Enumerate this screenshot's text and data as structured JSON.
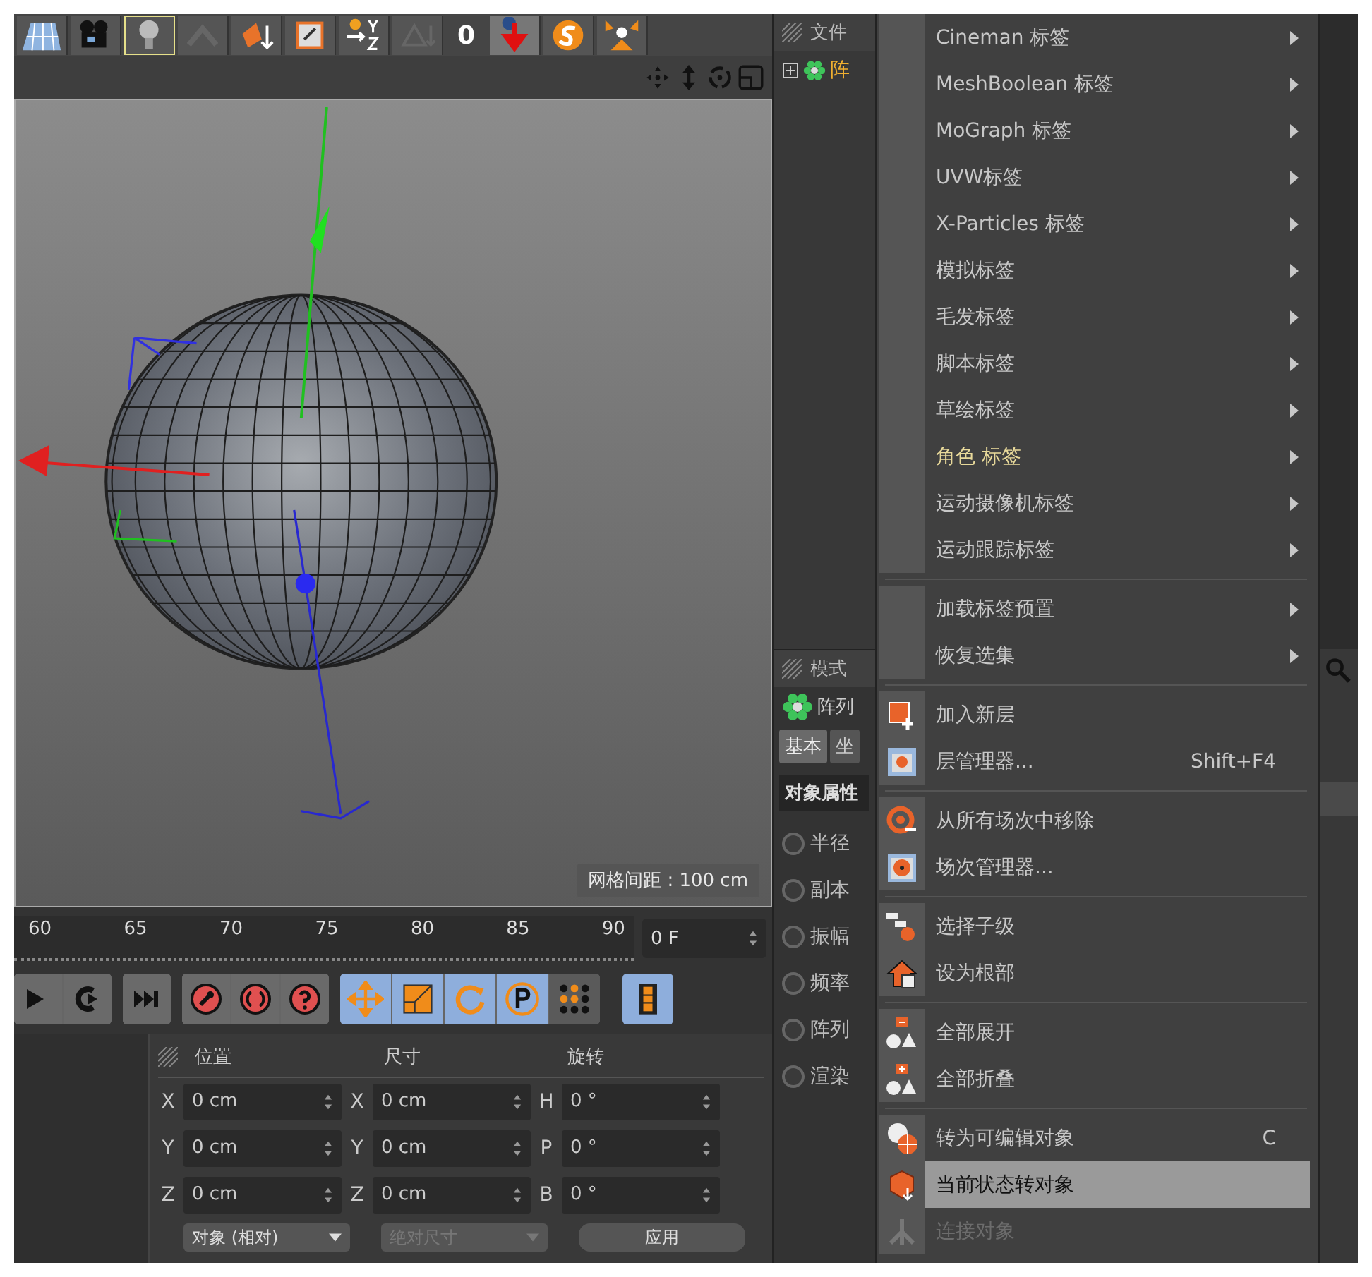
{
  "toolbar": {
    "counter": "0"
  },
  "viewport": {
    "grid_label": "网格间距 : 100 cm"
  },
  "timeline": {
    "ticks": [
      "60",
      "65",
      "70",
      "75",
      "80",
      "85",
      "90"
    ],
    "frame": "0 F"
  },
  "tool_buttons": [
    {
      "kind": "move",
      "on": true
    },
    {
      "kind": "scale",
      "on": true
    },
    {
      "kind": "rotate",
      "on": true
    },
    {
      "kind": "param",
      "on": true
    },
    {
      "kind": "points",
      "on": false
    },
    {
      "kind": "film",
      "on": true
    }
  ],
  "coordinates": {
    "headers": [
      "位置",
      "尺寸",
      "旋转"
    ],
    "rows": [
      {
        "axis_a": "X",
        "value_a": "0 cm",
        "axis_b": "X",
        "value_b": "0 cm",
        "axis_c": "H",
        "value_c": "0 °"
      },
      {
        "axis_a": "Y",
        "value_a": "0 cm",
        "axis_b": "Y",
        "value_b": "0 cm",
        "axis_c": "P",
        "value_c": "0 °"
      },
      {
        "axis_a": "Z",
        "value_a": "0 cm",
        "axis_b": "Z",
        "value_b": "0 cm",
        "axis_c": "B",
        "value_c": "0 °"
      }
    ],
    "mode_dropdown": "对象 (相对)",
    "size_dropdown": {
      "label": "绝对尺寸",
      "disabled": true
    },
    "apply_button": "应用"
  },
  "object_manager": {
    "menu_label": "文件",
    "tree_item": "阵"
  },
  "attributes": {
    "mode_label": "模式",
    "object_name": "阵列",
    "tabs": [
      {
        "label": "基本",
        "selected": true
      },
      {
        "label": "坐",
        "selected": false
      }
    ],
    "section": "对象属性",
    "params": [
      {
        "label": "半径",
        "checked": false
      },
      {
        "label": "副本",
        "checked": false
      },
      {
        "label": "振幅",
        "checked": false
      },
      {
        "label": "频率",
        "checked": false
      },
      {
        "label": "阵列",
        "checked": false
      },
      {
        "label": "渲染",
        "checked": false
      }
    ]
  },
  "context_menu": {
    "groups": [
      {
        "items": [
          {
            "label": "Cineman 标签",
            "kind": "submenu",
            "selected": false,
            "disabled": false,
            "highlighted": false
          },
          {
            "label": "MeshBoolean 标签",
            "kind": "submenu",
            "selected": false,
            "disabled": false,
            "highlighted": false
          },
          {
            "label": "MoGraph 标签",
            "kind": "submenu",
            "selected": false,
            "disabled": false,
            "highlighted": false
          },
          {
            "label": "UVW标签",
            "kind": "submenu",
            "selected": false,
            "disabled": false,
            "highlighted": false
          },
          {
            "label": "X-Particles 标签",
            "kind": "submenu",
            "selected": false,
            "disabled": false,
            "highlighted": false
          },
          {
            "label": "模拟标签",
            "kind": "submenu",
            "selected": false,
            "disabled": false,
            "highlighted": false
          },
          {
            "label": "毛发标签",
            "kind": "submenu",
            "selected": false,
            "disabled": false,
            "highlighted": false
          },
          {
            "label": "脚本标签",
            "kind": "submenu",
            "selected": false,
            "disabled": false,
            "highlighted": false
          },
          {
            "label": "草绘标签",
            "kind": "submenu",
            "selected": false,
            "disabled": false,
            "highlighted": false
          },
          {
            "label": "角色 标签",
            "kind": "submenu",
            "selected": false,
            "disabled": false,
            "highlighted": true
          },
          {
            "label": "运动摄像机标签",
            "kind": "submenu",
            "selected": false,
            "disabled": false,
            "highlighted": false
          },
          {
            "label": "运动跟踪标签",
            "kind": "submenu",
            "selected": false,
            "disabled": false,
            "highlighted": false
          }
        ]
      },
      {
        "items": [
          {
            "label": "加载标签预置",
            "kind": "submenu",
            "selected": false,
            "disabled": false,
            "highlighted": false
          },
          {
            "label": "恢复选集",
            "kind": "submenu",
            "selected": false,
            "disabled": false,
            "highlighted": false
          }
        ]
      },
      {
        "items": [
          {
            "label": "加入新层",
            "kind": "command",
            "selected": false,
            "disabled": false,
            "highlighted": false
          },
          {
            "label": "层管理器...",
            "shortcut": "Shift+F4",
            "kind": "command",
            "selected": false,
            "disabled": false,
            "highlighted": false
          }
        ]
      },
      {
        "items": [
          {
            "label": "从所有场次中移除",
            "kind": "command",
            "selected": false,
            "disabled": false,
            "highlighted": false
          },
          {
            "label": "场次管理器...",
            "kind": "command",
            "selected": false,
            "disabled": false,
            "highlighted": false
          }
        ]
      },
      {
        "items": [
          {
            "label": "选择子级",
            "kind": "command",
            "selected": false,
            "disabled": false,
            "highlighted": false
          },
          {
            "label": "设为根部",
            "kind": "command",
            "selected": false,
            "disabled": false,
            "highlighted": false
          }
        ]
      },
      {
        "items": [
          {
            "label": "全部展开",
            "kind": "command",
            "selected": false,
            "disabled": false,
            "highlighted": false
          },
          {
            "label": "全部折叠",
            "kind": "command",
            "selected": false,
            "disabled": false,
            "highlighted": false
          }
        ]
      },
      {
        "items": [
          {
            "label": "转为可编辑对象",
            "shortcut": "C",
            "kind": "command",
            "selected": false,
            "disabled": false,
            "highlighted": false
          },
          {
            "label": "当前状态转对象",
            "kind": "command",
            "selected": true,
            "disabled": false,
            "highlighted": false
          },
          {
            "label": "连接对象",
            "kind": "command",
            "selected": false,
            "disabled": true,
            "highlighted": false
          }
        ]
      }
    ]
  }
}
